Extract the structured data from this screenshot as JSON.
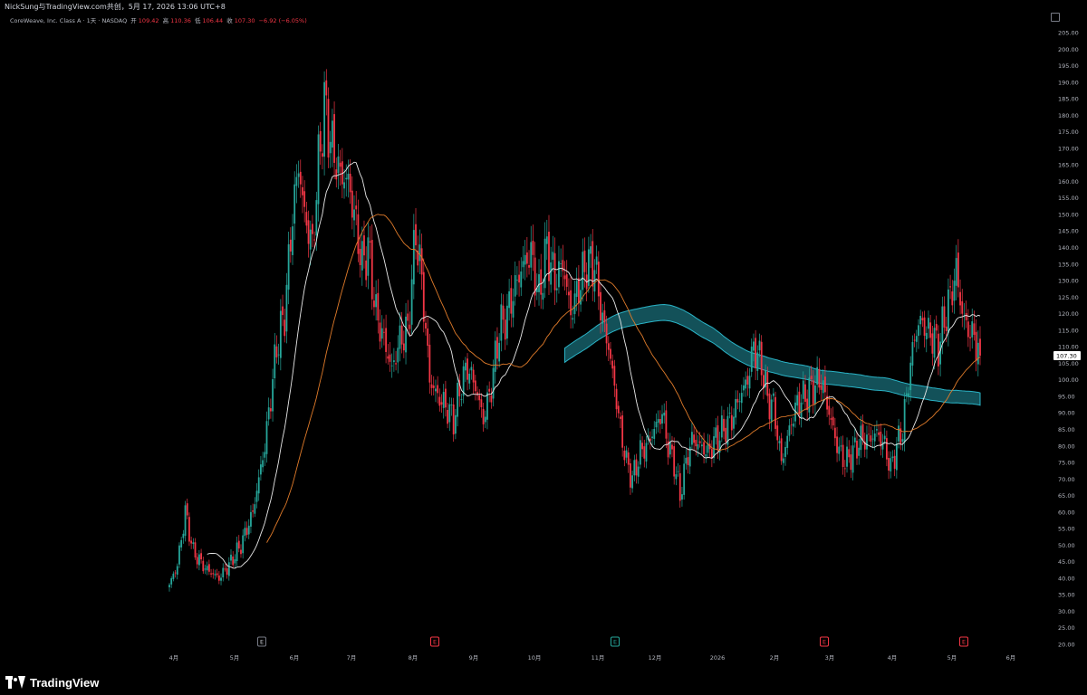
{
  "header": {
    "published_by": "NickSung与TradingView.com共创，5月 17, 2026 13:06 UTC+8"
  },
  "legend": {
    "symbol": "CoreWeave, Inc. Class A · 1天 · NASDAQ",
    "open_label": "开",
    "open_value": "109.42",
    "high_label": "高",
    "high_value": "110.36",
    "low_label": "低",
    "low_value": "106.44",
    "close_label": "收",
    "close_value": "107.30",
    "change": "−6.92 (−6.05%)"
  },
  "footer": {
    "brand": "TradingView"
  },
  "colors": {
    "up": "#26a69a",
    "down": "#f23645",
    "ma_short": "#e8e8e8",
    "ma_mid": "#e07b2a",
    "ribbon": "#2ab3c6",
    "grid_text": "#b2b5be"
  },
  "chart_data": {
    "type": "candlestick",
    "title": "CoreWeave, Inc. Class A · 1天 · NASDAQ",
    "y_axis": {
      "min": 20,
      "max": 205,
      "ticks": [
        205,
        200,
        195,
        190,
        185,
        180,
        175,
        170,
        165,
        160,
        155,
        150,
        145,
        140,
        135,
        130,
        125,
        120,
        115,
        110,
        105,
        100,
        95,
        90,
        85,
        80,
        75,
        70,
        65,
        60,
        55,
        50,
        45,
        40,
        35,
        30,
        25,
        20
      ],
      "position": "right",
      "last_price": 107.3
    },
    "x_axis": {
      "labels": [
        "4月",
        "5月",
        "6月",
        "7月",
        "8月",
        "9月",
        "10月",
        "11月",
        "12月",
        "2026",
        "2月",
        "3月",
        "4月",
        "5月",
        "6月"
      ]
    },
    "earnings_markers": [
      {
        "label": "E",
        "month": "5月",
        "color": "#787b86"
      },
      {
        "label": "E",
        "month": "8月",
        "color": "#f23645"
      },
      {
        "label": "E",
        "month": "11月",
        "color": "#26a69a"
      },
      {
        "label": "E",
        "month": "2月",
        "color": "#f23645"
      },
      {
        "label": "E",
        "month": "5月",
        "color": "#f23645"
      }
    ],
    "anchors": [
      [
        0,
        38
      ],
      [
        4,
        44
      ],
      [
        8,
        60
      ],
      [
        12,
        48
      ],
      [
        18,
        43
      ],
      [
        25,
        40
      ],
      [
        30,
        44
      ],
      [
        36,
        50
      ],
      [
        42,
        60
      ],
      [
        48,
        80
      ],
      [
        54,
        110
      ],
      [
        58,
        120
      ],
      [
        62,
        150
      ],
      [
        65,
        165
      ],
      [
        68,
        150
      ],
      [
        72,
        140
      ],
      [
        75,
        165
      ],
      [
        78,
        183
      ],
      [
        82,
        170
      ],
      [
        86,
        162
      ],
      [
        90,
        160
      ],
      [
        93,
        150
      ],
      [
        97,
        135
      ],
      [
        100,
        140
      ],
      [
        104,
        120
      ],
      [
        108,
        112
      ],
      [
        112,
        103
      ],
      [
        116,
        112
      ],
      [
        120,
        115
      ],
      [
        124,
        145
      ],
      [
        127,
        130
      ],
      [
        131,
        100
      ],
      [
        135,
        95
      ],
      [
        139,
        92
      ],
      [
        143,
        88
      ],
      [
        147,
        99
      ],
      [
        150,
        104
      ],
      [
        154,
        98
      ],
      [
        158,
        88
      ],
      [
        162,
        98
      ],
      [
        166,
        115
      ],
      [
        170,
        120
      ],
      [
        174,
        128
      ],
      [
        178,
        135
      ],
      [
        182,
        138
      ],
      [
        186,
        125
      ],
      [
        190,
        140
      ],
      [
        194,
        130
      ],
      [
        198,
        135
      ],
      [
        202,
        120
      ],
      [
        206,
        128
      ],
      [
        210,
        135
      ],
      [
        214,
        135
      ],
      [
        218,
        118
      ],
      [
        221,
        110
      ],
      [
        224,
        98
      ],
      [
        227,
        85
      ],
      [
        230,
        75
      ],
      [
        233,
        70
      ],
      [
        237,
        78
      ],
      [
        240,
        80
      ],
      [
        244,
        85
      ],
      [
        248,
        90
      ],
      [
        251,
        80
      ],
      [
        254,
        75
      ],
      [
        257,
        65
      ],
      [
        260,
        75
      ],
      [
        263,
        82
      ],
      [
        267,
        80
      ],
      [
        271,
        78
      ],
      [
        275,
        82
      ],
      [
        279,
        85
      ],
      [
        283,
        88
      ],
      [
        287,
        95
      ],
      [
        291,
        100
      ],
      [
        294,
        110
      ],
      [
        298,
        105
      ],
      [
        301,
        94
      ],
      [
        304,
        92
      ],
      [
        308,
        75
      ],
      [
        312,
        85
      ],
      [
        316,
        93
      ],
      [
        320,
        95
      ],
      [
        324,
        98
      ],
      [
        328,
        100
      ],
      [
        332,
        90
      ],
      [
        336,
        80
      ],
      [
        340,
        75
      ],
      [
        344,
        78
      ],
      [
        348,
        82
      ],
      [
        352,
        82
      ],
      [
        356,
        84
      ],
      [
        360,
        80
      ],
      [
        363,
        73
      ],
      [
        366,
        80
      ],
      [
        369,
        85
      ],
      [
        372,
        100
      ],
      [
        375,
        113
      ],
      [
        378,
        118
      ],
      [
        381,
        115
      ],
      [
        384,
        113
      ],
      [
        387,
        110
      ],
      [
        390,
        118
      ],
      [
        393,
        125
      ],
      [
        396,
        133
      ],
      [
        399,
        120
      ],
      [
        402,
        115
      ],
      [
        405,
        113
      ],
      [
        408,
        107.3
      ]
    ],
    "series": [
      {
        "name": "",
        "kind": "short_ma",
        "color": "#e8e8e8"
      },
      {
        "name": "",
        "kind": "mid_ma",
        "color": "#e07b2a"
      },
      {
        "name": "",
        "kind": "long_ma_band",
        "color": "#2ab3c6"
      }
    ],
    "grid": false,
    "legend_position": "top-left"
  }
}
